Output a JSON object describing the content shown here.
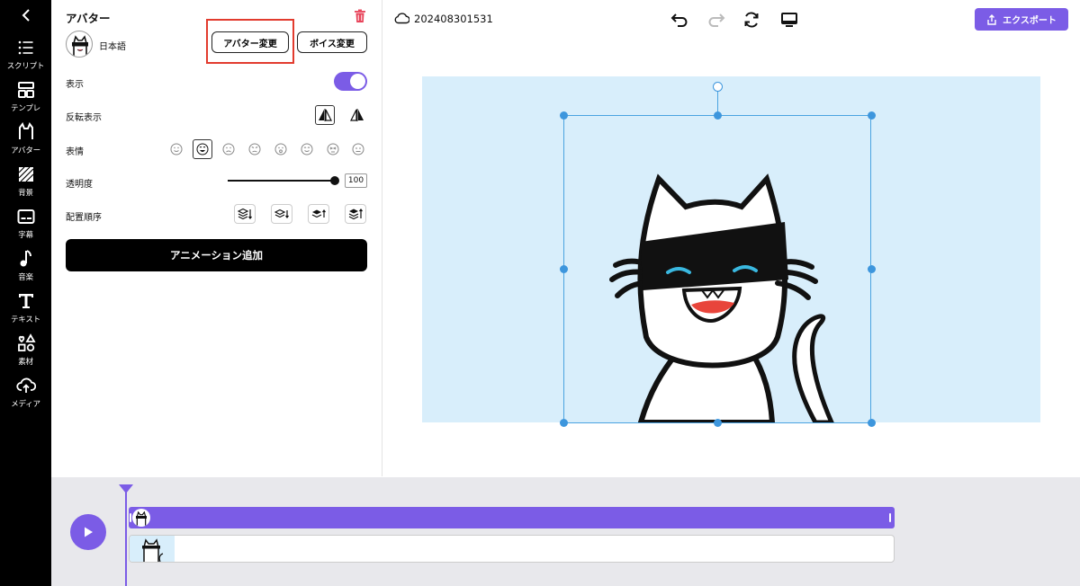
{
  "panel": {
    "title": "アバター",
    "language": "日本語",
    "change_avatar": "アバター変更",
    "change_voice": "ボイス変更",
    "rows": {
      "display": "表示",
      "flip": "反転表示",
      "expression": "表情",
      "opacity": "透明度",
      "order": "配置順序"
    },
    "display_on": true,
    "opacity_value": "100",
    "add_animation": "アニメーション追加"
  },
  "sidebar": {
    "items": [
      {
        "label": "スクリプト",
        "icon": "script-list-icon"
      },
      {
        "label": "テンプレ",
        "icon": "template-icon"
      },
      {
        "label": "アバター",
        "icon": "avatar-icon"
      },
      {
        "label": "背景",
        "icon": "background-icon"
      },
      {
        "label": "字幕",
        "icon": "subtitle-icon"
      },
      {
        "label": "音楽",
        "icon": "music-icon"
      },
      {
        "label": "テキスト",
        "icon": "text-icon"
      },
      {
        "label": "素材",
        "icon": "material-icon"
      },
      {
        "label": "メディア",
        "icon": "media-upload-icon"
      }
    ]
  },
  "header": {
    "project_name": "202408301531",
    "export_label": "エクスポート"
  },
  "colors": {
    "accent": "#7b5ce6",
    "canvas_bg": "#d8eefb",
    "selection": "#3d96dd",
    "highlight": "#e23b2e"
  }
}
